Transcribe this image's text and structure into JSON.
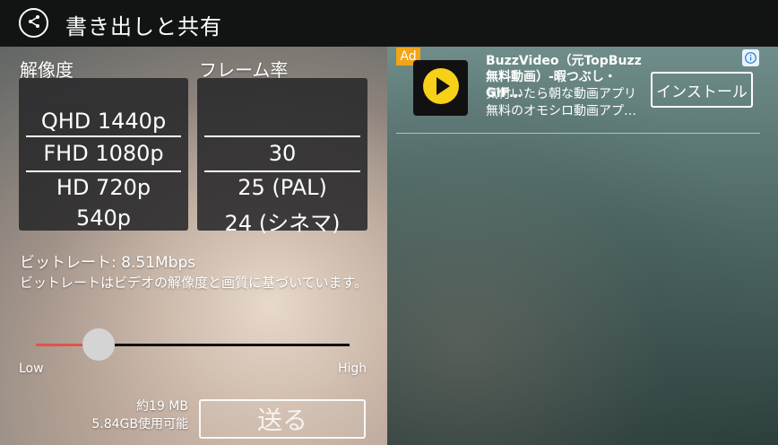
{
  "header": {
    "title": "書き出しと共有",
    "back_icon": "share-back-icon"
  },
  "resolution": {
    "label": "解像度",
    "options": [
      "QHD 1440p",
      "FHD 1080p",
      "HD 720p",
      "540p"
    ],
    "selected": "FHD 1080p"
  },
  "framerate": {
    "label": "フレーム率",
    "options": [
      "30",
      "25 (PAL)",
      "24 (シネマ)"
    ],
    "selected": "30"
  },
  "bitrate": {
    "text": "ビットレート: 8.51Mbps",
    "description": "ビットレートはビデオの解像度と画質に基づいています。",
    "slider_low": "Low",
    "slider_high": "High",
    "slider_value": 0.2
  },
  "output": {
    "size": "約19 MB",
    "available": "5.84GB使用可能",
    "send_label": "送る"
  },
  "ad": {
    "badge": "Ad",
    "title": "BuzzVideo（元TopBuzz無料動画）-暇つぶし・GIF…",
    "description": "気付いたら朝な動画アプリ無料のオモシロ動画アプ…",
    "install_label": "インストール",
    "info_icon": "info-icon",
    "app_icon": "play-icon"
  },
  "colors": {
    "accent": "#e0524f",
    "ad_badge": "#f2a516",
    "app_icon_yellow": "#f7d018"
  }
}
